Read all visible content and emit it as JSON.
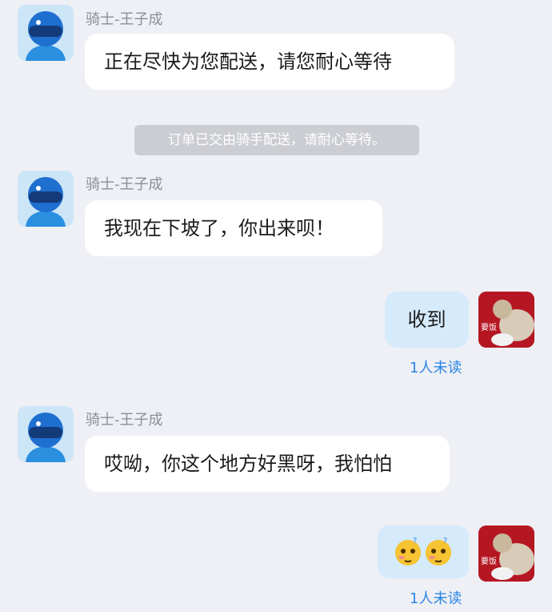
{
  "messages": [
    {
      "sender": "骑士-王子成",
      "text": "正在尽快为您配送，请您耐心等待"
    },
    {
      "system": "订单已交由骑手配送，请耐心等待。"
    },
    {
      "sender": "骑士-王子成",
      "text": "我现在下坡了，你出来呗！"
    },
    {
      "self_text": "收到",
      "status": "1人未读",
      "avatar_text": "要饭"
    },
    {
      "sender": "骑士-王子成",
      "text": "哎呦，你这个地方好黑呀，我怕怕"
    },
    {
      "self_emoji": "shy-confused-face-emoji x2",
      "status": "1人未读",
      "avatar_text": "要饭"
    }
  ],
  "colors": {
    "background": "#eef0f5",
    "self_bubble": "#d5eafb",
    "read_status": "#2c86e6",
    "system_pill": "#cbcdd3"
  }
}
